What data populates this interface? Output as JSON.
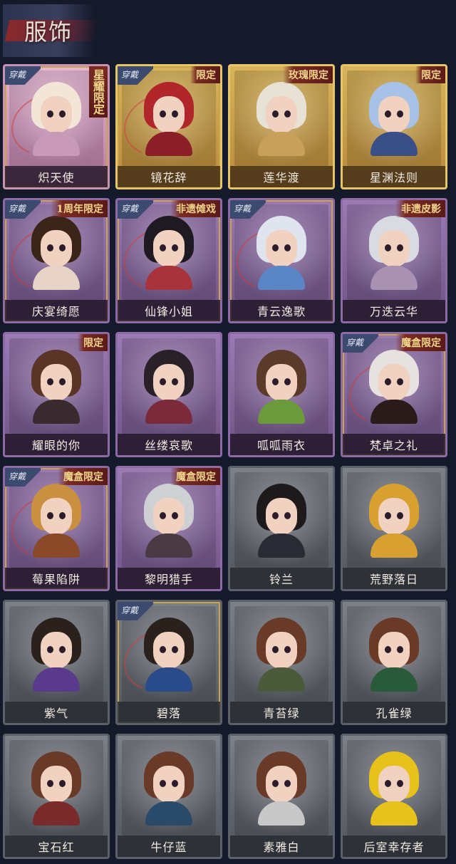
{
  "header": {
    "title": "服饰"
  },
  "items": [
    {
      "name": "炽天使",
      "tag": "星耀限定",
      "tag_style": "vertical",
      "equipped": true,
      "frame": "pink",
      "hair": "#f2e6d8",
      "body": "#c89ab8"
    },
    {
      "name": "镜花辞",
      "tag": "限定",
      "tag_style": "horizontal",
      "equipped": true,
      "frame": "gold",
      "hair": "#b1262a",
      "body": "#8a1f28"
    },
    {
      "name": "莲华渡",
      "tag": "玫瑰限定",
      "tag_style": "horizontal",
      "equipped": false,
      "frame": "gold",
      "hair": "#e7e1d6",
      "body": "#c8a05a"
    },
    {
      "name": "星渊法则",
      "tag": "限定",
      "tag_style": "horizontal",
      "equipped": false,
      "frame": "gold",
      "hair": "#a7c2e6",
      "body": "#3a4f88"
    },
    {
      "name": "庆宴绮愿",
      "tag": "1周年限定",
      "tag_style": "horizontal",
      "equipped": true,
      "frame": "purple",
      "hair": "#3b2418",
      "body": "#e7d4c6"
    },
    {
      "name": "仙锋小姐",
      "tag": "非遗傩戏",
      "tag_style": "horizontal",
      "equipped": true,
      "frame": "purple",
      "hair": "#1f1a22",
      "body": "#a8333a"
    },
    {
      "name": "青云逸歌",
      "tag": "",
      "tag_style": "horizontal",
      "equipped": true,
      "frame": "purple",
      "hair": "#dfe4ee",
      "body": "#5a86c6"
    },
    {
      "name": "万迭云华",
      "tag": "非遗皮影",
      "tag_style": "horizontal",
      "equipped": false,
      "frame": "purple",
      "hair": "#d8dce2",
      "body": "#a991b2"
    },
    {
      "name": "耀眼的你",
      "tag": "限定",
      "tag_style": "horizontal",
      "equipped": false,
      "frame": "purple",
      "hair": "#5a3426",
      "body": "#3a2a30"
    },
    {
      "name": "丝缕哀歌",
      "tag": "",
      "tag_style": "horizontal",
      "equipped": false,
      "frame": "purple",
      "hair": "#2a2028",
      "body": "#7a2a3a"
    },
    {
      "name": "呱呱雨衣",
      "tag": "",
      "tag_style": "horizontal",
      "equipped": false,
      "frame": "purple",
      "hair": "#5a3a28",
      "body": "#6a9a3a"
    },
    {
      "name": "梵卓之礼",
      "tag": "魔盒限定",
      "tag_style": "horizontal",
      "equipped": true,
      "frame": "purple",
      "hair": "#e6e2e0",
      "body": "#2a1a1a"
    },
    {
      "name": "莓果陷阱",
      "tag": "魔盒限定",
      "tag_style": "horizontal",
      "equipped": true,
      "frame": "purple",
      "hair": "#c89040",
      "body": "#8a4a2a"
    },
    {
      "name": "黎明猎手",
      "tag": "魔盒限定",
      "tag_style": "horizontal",
      "equipped": false,
      "frame": "purple",
      "hair": "#cfd0d4",
      "body": "#4a3a44"
    },
    {
      "name": "铃兰",
      "tag": "",
      "tag_style": "horizontal",
      "equipped": false,
      "frame": "gray",
      "hair": "#1e1a1c",
      "body": "#2a2a34"
    },
    {
      "name": "荒野落日",
      "tag": "",
      "tag_style": "horizontal",
      "equipped": false,
      "frame": "gray",
      "hair": "#d8a030",
      "body": "#d8a030"
    },
    {
      "name": "紫气",
      "tag": "",
      "tag_style": "horizontal",
      "equipped": false,
      "frame": "gray",
      "hair": "#2a201c",
      "body": "#5a3a8a"
    },
    {
      "name": "碧落",
      "tag": "",
      "tag_style": "horizontal",
      "equipped": true,
      "frame": "gray",
      "hair": "#2a201c",
      "body": "#2a4a8a"
    },
    {
      "name": "青苔绿",
      "tag": "",
      "tag_style": "horizontal",
      "equipped": false,
      "frame": "gray",
      "hair": "#6a3a28",
      "body": "#4a5a3a"
    },
    {
      "name": "孔雀绿",
      "tag": "",
      "tag_style": "horizontal",
      "equipped": false,
      "frame": "gray",
      "hair": "#6a3a28",
      "body": "#2a5a3a"
    },
    {
      "name": "宝石红",
      "tag": "",
      "tag_style": "horizontal",
      "equipped": false,
      "frame": "gray",
      "hair": "#6a3a28",
      "body": "#7a2a2a"
    },
    {
      "name": "牛仔蓝",
      "tag": "",
      "tag_style": "horizontal",
      "equipped": false,
      "frame": "gray",
      "hair": "#6a3a28",
      "body": "#2a4a6a"
    },
    {
      "name": "素雅白",
      "tag": "",
      "tag_style": "horizontal",
      "equipped": false,
      "frame": "gray",
      "hair": "#6a3a28",
      "body": "#c8c8c8"
    },
    {
      "name": "后室幸存者",
      "tag": "",
      "tag_style": "horizontal",
      "equipped": false,
      "frame": "gray",
      "hair": "#e6c21a",
      "body": "#e6c21a"
    }
  ],
  "labels": {
    "equipped": "穿戴"
  }
}
